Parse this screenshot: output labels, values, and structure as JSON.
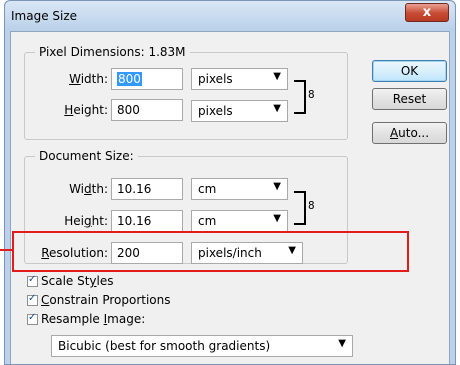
{
  "window": {
    "title": "Image Size",
    "close_label": "x"
  },
  "pixel_dimensions": {
    "legend": "Pixel Dimensions:  1.83M",
    "width": {
      "label_pre": "",
      "label_ul": "W",
      "label_post": "idth:",
      "value": "800",
      "unit": "pixels"
    },
    "height": {
      "label_pre": "",
      "label_ul": "H",
      "label_post": "eight:",
      "value": "800",
      "unit": "pixels"
    }
  },
  "document_size": {
    "legend": "Document Size:",
    "width": {
      "label_pre": "Wi",
      "label_ul": "d",
      "label_post": "th:",
      "value": "10.16",
      "unit": "cm"
    },
    "height": {
      "label_pre": "Hei",
      "label_ul": "g",
      "label_post": "ht:",
      "value": "10.16",
      "unit": "cm"
    },
    "resolution": {
      "label_pre": "",
      "label_ul": "R",
      "label_post": "esolution:",
      "value": "200",
      "unit": "pixels/inch"
    }
  },
  "buttons": {
    "ok": "OK",
    "reset": "Reset",
    "auto_pre": "",
    "auto_ul": "A",
    "auto_post": "uto..."
  },
  "options": {
    "scale_styles": {
      "pre": "Scale St",
      "ul": "y",
      "post": "les",
      "checked": true
    },
    "constrain": {
      "pre": "",
      "ul": "C",
      "post": "onstrain Proportions",
      "checked": true
    },
    "resample": {
      "pre": "Resample ",
      "ul": "I",
      "post": "mage:",
      "checked": true
    },
    "resample_method": "Bicubic (best for smooth gradients)"
  },
  "icons": {
    "chain": "chain-link-icon",
    "dropdown": "chevron-down-icon"
  },
  "colors": {
    "highlight": "#e41b1b",
    "selection": "#3399ff"
  }
}
